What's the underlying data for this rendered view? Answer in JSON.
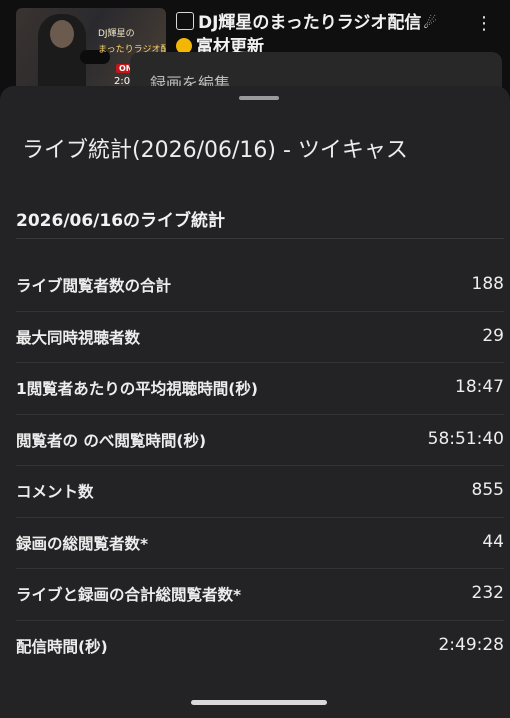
{
  "video": {
    "title_line1": "DJ輝星のまったりラジオ配信",
    "title_line2": "富材更新",
    "thumbnail_text1": "DJ輝星の",
    "thumbnail_text2": "まったりラジオ配信",
    "thumbnail_badge": "ON",
    "thumbnail_duration": "2:0",
    "more_icon": "kebab-menu-icon"
  },
  "menu": {
    "edit_recording": "録画を編集"
  },
  "sheet": {
    "title": "ライブ統計(2026/06/16) - ツイキャス",
    "section_title": "2026/06/16のライブ統計",
    "stats": [
      {
        "label": "ライブ閲覧者数の合計",
        "value": "188"
      },
      {
        "label": "最大同時視聴者数",
        "value": "29"
      },
      {
        "label": "1閲覧者あたりの平均視聴時間(秒)",
        "value": "18:47"
      },
      {
        "label": "閲覧者の のべ閲覧時間(秒)",
        "value": "58:51:40"
      },
      {
        "label": "コメント数",
        "value": "855"
      },
      {
        "label": "録画の総閲覧者数*",
        "value": "44"
      },
      {
        "label": "ライブと録画の合計総閲覧者数*",
        "value": "232"
      },
      {
        "label": "配信時間(秒)",
        "value": "2:49:28"
      }
    ]
  }
}
